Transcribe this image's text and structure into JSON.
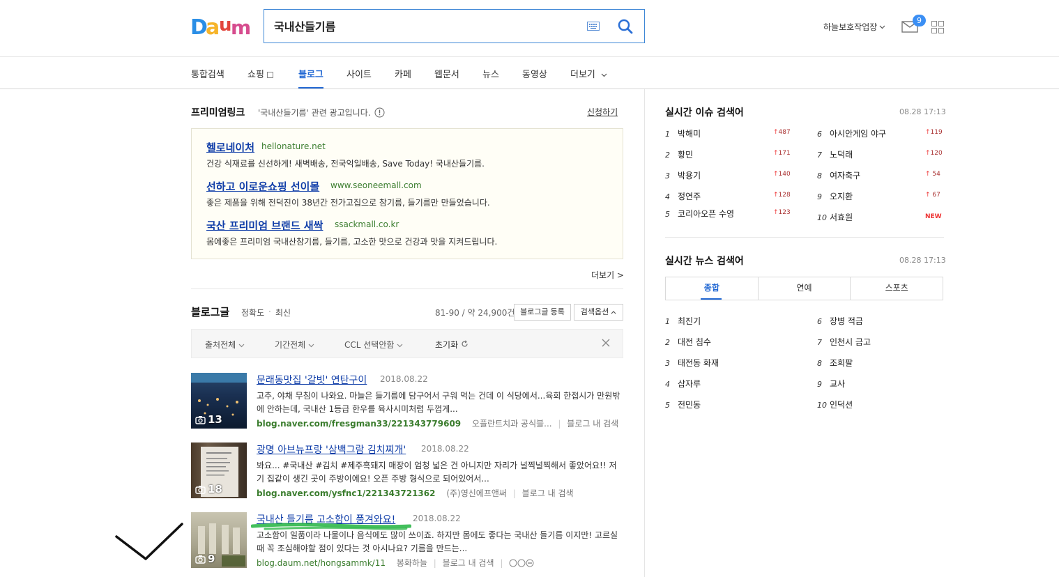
{
  "header": {
    "search_value": "국내산들기름",
    "user_name": "하늘보호작업장",
    "mail_count": "9"
  },
  "nav": {
    "tabs": [
      {
        "label": "통합검색"
      },
      {
        "label": "쇼핑"
      },
      {
        "label": "블로그"
      },
      {
        "label": "사이트"
      },
      {
        "label": "카페"
      },
      {
        "label": "웹문서"
      },
      {
        "label": "뉴스"
      },
      {
        "label": "동영상"
      },
      {
        "label": "더보기"
      }
    ]
  },
  "premium": {
    "title": "프리미엄링크",
    "desc": "'국내산들기름' 관련 광고입니다.",
    "apply": "신청하기",
    "ads": [
      {
        "title": "헬로네이처",
        "url": "hellonature.net",
        "desc": "건강 식재료를 신선하게! 새벽배송, 전국익일배송, Save Today! 국내산들기름."
      },
      {
        "title": "선하고 이로운쇼핑 선이몰",
        "url": "www.seoneemall.com",
        "desc": "좋은 제품을 위해 전덕진이 38년간 전가고집으로 참기름, 들기름만 만들었습니다."
      },
      {
        "title": "국산 프리미엄 브랜드 새싹",
        "url": "ssackmall.co.kr",
        "desc": "몸에좋은 프리미엄 국내산참기름, 들기름, 고소한 맛으로 건강과 맛을 지켜드립니다."
      }
    ],
    "more": "더보기 >"
  },
  "blog": {
    "title": "블로그글",
    "sort_accuracy": "정확도",
    "sort_dot": "·",
    "sort_recent": "최신",
    "count": "81-90 / 약 24,900건",
    "register_btn": "블로그글 등록",
    "options_btn": "검색옵션",
    "filters": {
      "source": "출처전체",
      "period": "기간전체",
      "ccl": "CCL 선택안함",
      "reset": "초기화"
    },
    "results": [
      {
        "title": "문래동맛집 '갈빗' 연탄구이",
        "date": "2018.08.22",
        "desc": "고추, 야채 무침이 나와요. 마늘은 들기름에 담구어서 구워 먹는 건데 이 식당에서...육회 한접시가 만원밖에 안하는데, 국내산 1등급 한우를 육사시미처럼 두껍게...",
        "url": "blog.naver.com/fresgman33/221343779609",
        "author": "오플란트치과 공식블...",
        "search_in": "블로그 내 검색",
        "photo_count": "13"
      },
      {
        "title": "광명 아브뉴프랑 '삼백그람 김치찌개'",
        "date": "2018.08.22",
        "desc": "봐요... #국내산 #김치 #제주흑돼지 매장이 엄청 넓은 건 아니지만 자리가 널찍널찍해서 좋았어요!! 저기 집같이 생긴 곳이 주방이에요! 오픈 주방 형식으로 되어있어서...",
        "url": "blog.naver.com/ysfnc1/221343721362",
        "author": "(주)영신에프앤써",
        "search_in": "블로그 내 검색",
        "photo_count": "18"
      },
      {
        "title": "국내산 들기름 고소함이 풍겨와요!",
        "date": "2018.08.22",
        "desc": "고소함이 일품이라 나물이나 음식에도 많이 쓰이죠. 하지만 몸에도 좋다는 국내산 들기름 이지만! 고르실 때 꼭 조심해야할 점이 있다는 것 아시나요? 기름을 만드는...",
        "url": "blog.daum.net/hongsammk/11",
        "author": "봉화하늘",
        "search_in": "블로그 내 검색",
        "photo_count": "9"
      }
    ]
  },
  "realtime_issue": {
    "title": "실시간 이슈 검색어",
    "time": "08.28  17:13",
    "items": [
      {
        "num": "1",
        "name": "박해미",
        "delta": "487"
      },
      {
        "num": "2",
        "name": "황민",
        "delta": "171"
      },
      {
        "num": "3",
        "name": "박용기",
        "delta": "140"
      },
      {
        "num": "4",
        "name": "정연주",
        "delta": "128"
      },
      {
        "num": "5",
        "name": "코리아오픈 수영",
        "delta": "123"
      },
      {
        "num": "6",
        "name": "아시안게임 야구",
        "delta": "119"
      },
      {
        "num": "7",
        "name": "노덕래",
        "delta": "120"
      },
      {
        "num": "8",
        "name": "여자축구",
        "delta": "54"
      },
      {
        "num": "9",
        "name": "오지환",
        "delta": "67"
      },
      {
        "num": "10",
        "name": "서효원",
        "delta": "NEW"
      }
    ]
  },
  "realtime_news": {
    "title": "실시간 뉴스 검색어",
    "time": "08.28  17:13",
    "tabs": [
      "종합",
      "연예",
      "스포츠"
    ],
    "items": [
      {
        "num": "1",
        "name": "최진기"
      },
      {
        "num": "2",
        "name": "대전 침수"
      },
      {
        "num": "3",
        "name": "태전동 화재"
      },
      {
        "num": "4",
        "name": "삽자루"
      },
      {
        "num": "5",
        "name": "전민동"
      },
      {
        "num": "6",
        "name": "장병 적금"
      },
      {
        "num": "7",
        "name": "인천시 금고"
      },
      {
        "num": "8",
        "name": "조희팔"
      },
      {
        "num": "9",
        "name": "교사"
      },
      {
        "num": "10",
        "name": "인덕션"
      }
    ]
  },
  "colors": {
    "accent": "#2268d3",
    "link": "#0f3da8",
    "url_green": "#3b7d2e",
    "up_red": "#e33"
  }
}
